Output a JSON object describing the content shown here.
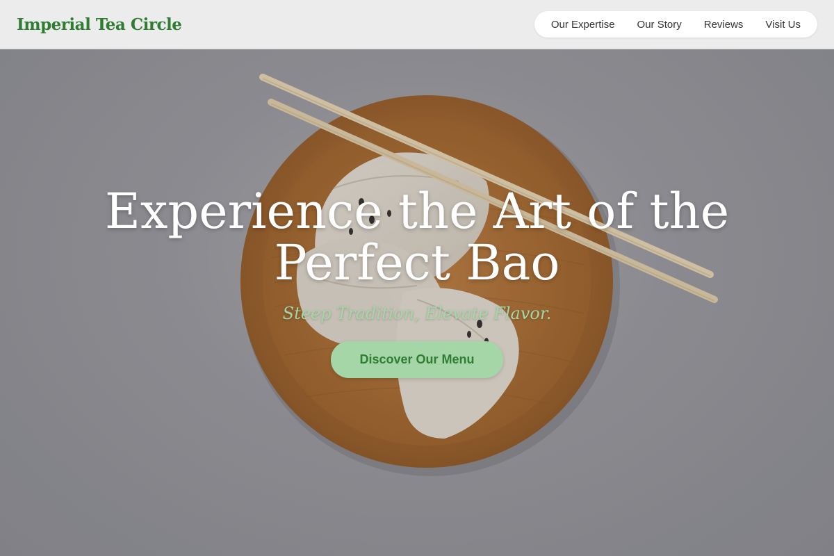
{
  "header": {
    "brand": "Imperial Tea Circle",
    "nav": [
      {
        "label": "Our Expertise"
      },
      {
        "label": "Our Story"
      },
      {
        "label": "Reviews"
      },
      {
        "label": "Visit Us"
      }
    ]
  },
  "hero": {
    "title": "Experience the Art of the Perfect Bao",
    "tagline": "Steep Tradition, Elevate Flavor.",
    "cta_label": "Discover Our Menu"
  },
  "colors": {
    "brand_green": "#2e7d32",
    "accent_light_green": "#a5d6a7",
    "header_bg": "#ececec",
    "wood": "#a8692f"
  },
  "icons": [
    "hero-food-image"
  ]
}
